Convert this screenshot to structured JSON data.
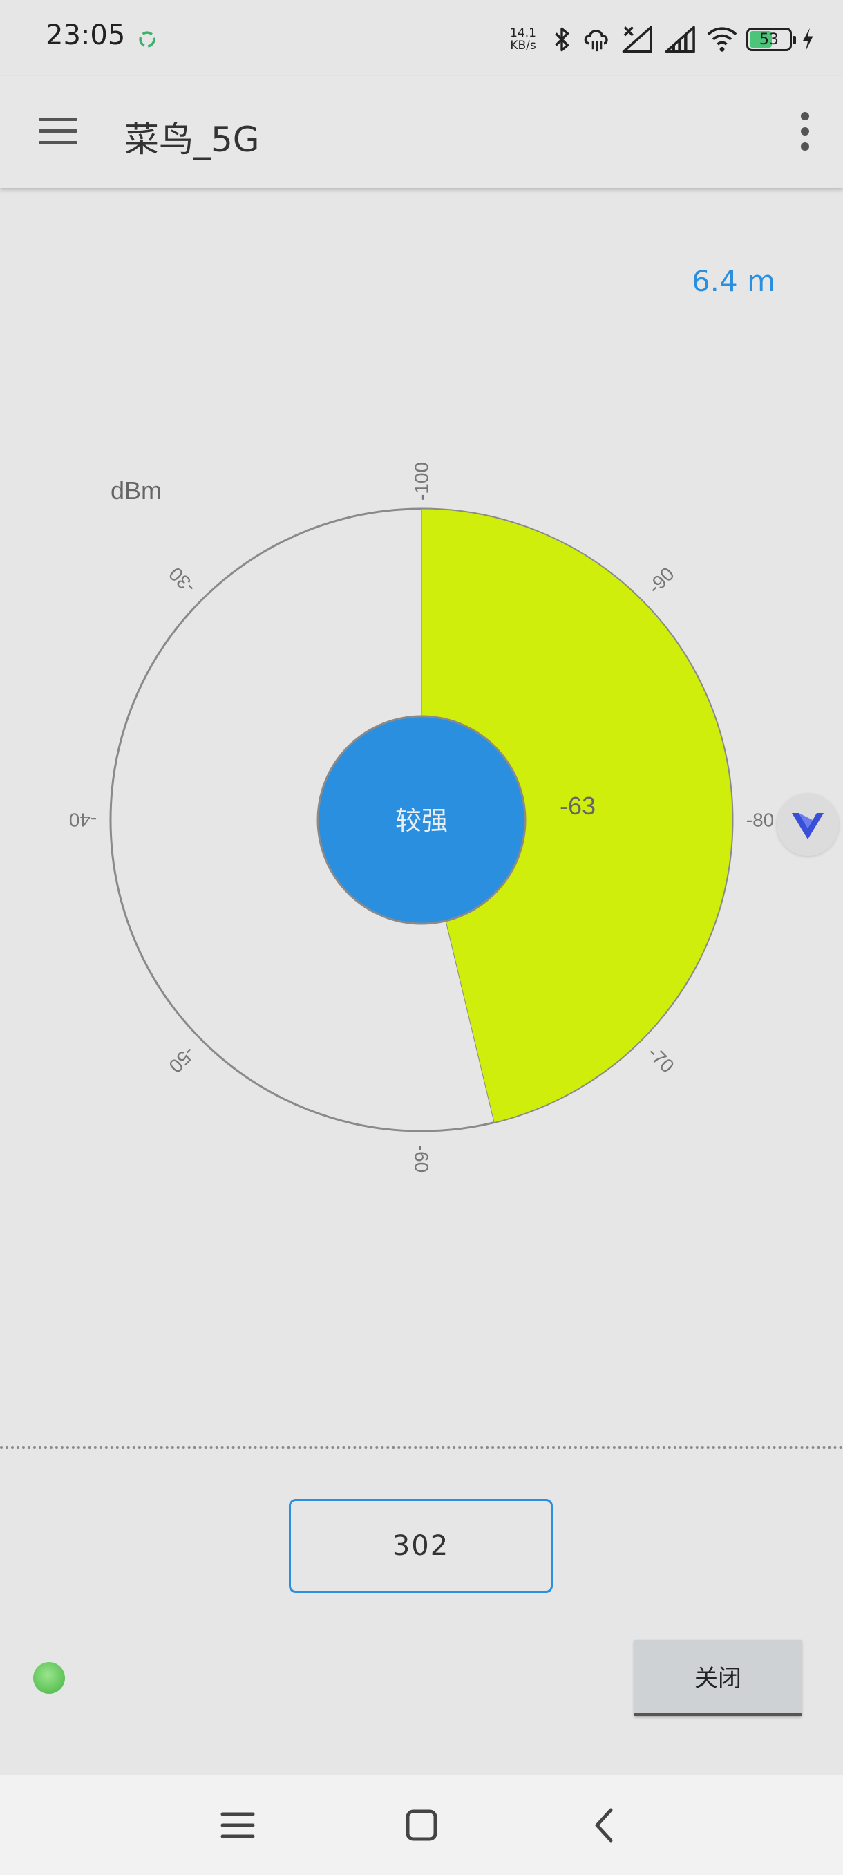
{
  "status_bar": {
    "time": "23:05",
    "net_speed_value": "14.1",
    "net_speed_unit": "KB/s",
    "battery_level": "53",
    "icons": [
      "recycle-icon",
      "bluetooth-icon",
      "cloud-sync-icon",
      "signal-no-service-icon",
      "signal-icon",
      "wifi-icon",
      "battery-icon",
      "charging-icon"
    ]
  },
  "app_bar": {
    "title": "菜鸟_5G",
    "icons": [
      "menu-icon",
      "more-vert-icon"
    ]
  },
  "main": {
    "distance": "6.4 m",
    "gauge": {
      "unit": "dBm",
      "center_label": "较强",
      "value_label": "-63",
      "value": -63,
      "scale_labels": [
        "-100",
        "-90",
        "-80",
        "-70",
        "-60",
        "-50",
        "-40",
        "-30"
      ],
      "colors": {
        "fill": "#cfee0b",
        "center": "#2b8fe0",
        "ring": "#8a8a8a"
      }
    },
    "channel": "302"
  },
  "footer": {
    "status_color": "#6cc763",
    "close_label": "关闭"
  },
  "nav_bar": {
    "icons": [
      "menu-lines-icon",
      "home-square-icon",
      "back-chevron-icon"
    ]
  },
  "floating_ball": {
    "icon": "v-logo-icon"
  }
}
